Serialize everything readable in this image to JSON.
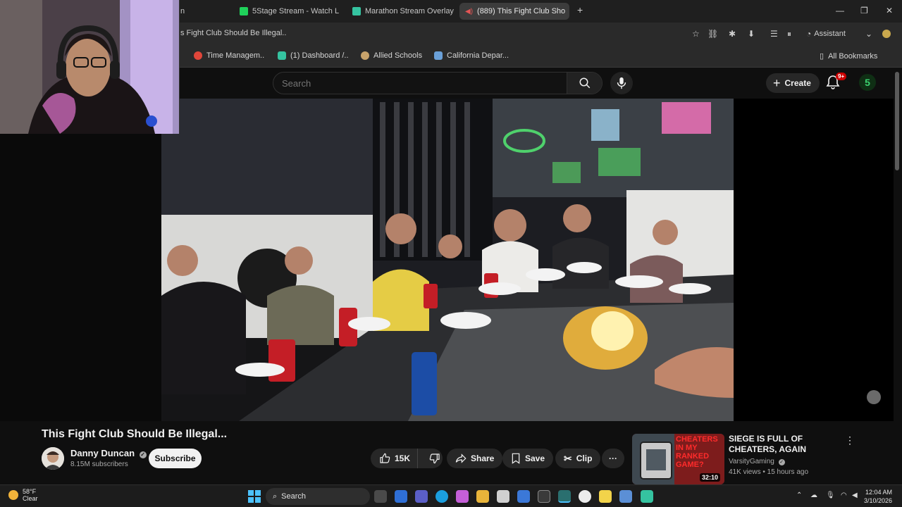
{
  "browser": {
    "tabs": [
      {
        "label": "n",
        "active": false
      },
      {
        "label": "5Stage Stream - Watch L",
        "active": false
      },
      {
        "label": "Marathon Stream Overlay",
        "active": false
      },
      {
        "label": "(889) This Fight Club Sho",
        "active": true
      }
    ],
    "new_tab": "+",
    "url": "s Fight Club Should Be Illegal..",
    "assistant_label": "Assistant",
    "bookmarks": [
      {
        "label": "Time Managem..",
        "color": "#e0463a"
      },
      {
        "label": "(1) Dashboard /..",
        "color": "#35c3a0"
      },
      {
        "label": "Allied Schools",
        "color": "#c8a36b"
      },
      {
        "label": "California Depar...",
        "color": "#6aa0d8"
      }
    ],
    "all_bookmarks": "All Bookmarks"
  },
  "youtube": {
    "search_placeholder": "Search",
    "create_label": "Create",
    "notifications_badge": "9+",
    "profile_letter": "5",
    "video": {
      "title": "This Fight Club Should Be Illegal...",
      "channel": "Danny Duncan",
      "subscribers": "8.15M subscribers",
      "subscribe_label": "Subscribe",
      "likes": "15K",
      "share_label": "Share",
      "save_label": "Save",
      "clip_label": "Clip",
      "more_label": "···"
    },
    "recommendation": {
      "title": "SIEGE IS FULL OF CHEATERS, AGAIN",
      "channel": "VarsityGaming",
      "meta": "41K views • 15 hours ago",
      "duration": "32:10",
      "thumb_text": "CHEATERS IN MY RANKED GAME?"
    }
  },
  "taskbar": {
    "temperature": "58°F",
    "condition": "Clear",
    "search_label": "Search",
    "time": "12:04 AM",
    "date": "3/10/2026"
  },
  "colors": {
    "accent_red": "#cc0000",
    "background": "#0f0f0f",
    "pill": "#272727"
  }
}
